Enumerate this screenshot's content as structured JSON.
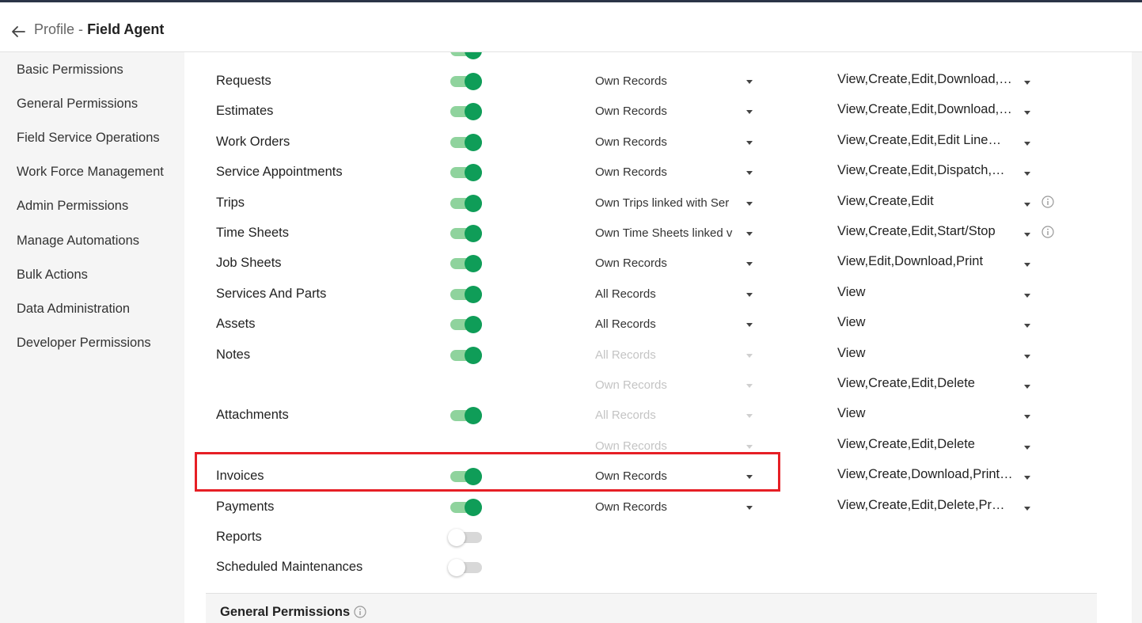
{
  "header": {
    "crumb": "Profile",
    "separator": "-",
    "title": "Field Agent"
  },
  "sidebar": {
    "items": [
      {
        "label": "Basic Permissions"
      },
      {
        "label": "General Permissions"
      },
      {
        "label": "Field Service Operations"
      },
      {
        "label": "Work Force Management"
      },
      {
        "label": "Admin Permissions"
      },
      {
        "label": "Manage Automations"
      },
      {
        "label": "Bulk Actions"
      },
      {
        "label": "Data Administration"
      },
      {
        "label": "Developer Permissions"
      }
    ]
  },
  "modules": {
    "rows": [
      {
        "name": "Requests",
        "enabled": true,
        "scope": "Own Records",
        "scope_disabled": false,
        "perms": "View,Create,Edit,Download,…",
        "info": false
      },
      {
        "name": "Estimates",
        "enabled": true,
        "scope": "Own Records",
        "scope_disabled": false,
        "perms": "View,Create,Edit,Download,…",
        "info": false
      },
      {
        "name": "Work Orders",
        "enabled": true,
        "scope": "Own Records",
        "scope_disabled": false,
        "perms": "View,Create,Edit,Edit Line…",
        "info": false
      },
      {
        "name": "Service Appointments",
        "enabled": true,
        "scope": "Own Records",
        "scope_disabled": false,
        "perms": "View,Create,Edit,Dispatch,…",
        "info": false
      },
      {
        "name": "Trips",
        "enabled": true,
        "scope": "Own Trips linked with Ser",
        "scope_disabled": false,
        "perms": "View,Create,Edit",
        "info": true
      },
      {
        "name": "Time Sheets",
        "enabled": true,
        "scope": "Own Time Sheets linked v",
        "scope_disabled": false,
        "perms": "View,Create,Edit,Start/Stop",
        "info": true
      },
      {
        "name": "Job Sheets",
        "enabled": true,
        "scope": "Own Records",
        "scope_disabled": false,
        "perms": "View,Edit,Download,Print",
        "info": false
      },
      {
        "name": "Services And Parts",
        "enabled": true,
        "scope": "All Records",
        "scope_disabled": false,
        "perms": "View",
        "info": false
      },
      {
        "name": "Assets",
        "enabled": true,
        "scope": "All Records",
        "scope_disabled": false,
        "perms": "View",
        "info": false
      },
      {
        "name": "Notes",
        "enabled": true,
        "scope": "All Records",
        "scope_disabled": true,
        "perms": "View",
        "info": false
      },
      {
        "name": "",
        "enabled": null,
        "scope": "Own Records",
        "scope_disabled": true,
        "perms": "View,Create,Edit,Delete",
        "info": false
      },
      {
        "name": "Attachments",
        "enabled": true,
        "scope": "All Records",
        "scope_disabled": true,
        "perms": "View",
        "info": false
      },
      {
        "name": "",
        "enabled": null,
        "scope": "Own Records",
        "scope_disabled": true,
        "perms": "View,Create,Edit,Delete",
        "info": false
      },
      {
        "name": "Invoices",
        "enabled": true,
        "scope": "Own Records",
        "scope_disabled": false,
        "perms": "View,Create,Download,Print…",
        "info": false
      },
      {
        "name": "Payments",
        "enabled": true,
        "scope": "Own Records",
        "scope_disabled": false,
        "perms": "View,Create,Edit,Delete,Pr…",
        "info": false
      },
      {
        "name": "Reports",
        "enabled": false,
        "scope": null,
        "scope_disabled": false,
        "perms": null,
        "info": false
      },
      {
        "name": "Scheduled Maintenances",
        "enabled": false,
        "scope": null,
        "scope_disabled": false,
        "perms": null,
        "info": false
      }
    ]
  },
  "section": {
    "title": "General Permissions"
  },
  "colors": {
    "toggle_on": "#0f9d58",
    "highlight": "#e61f25"
  }
}
